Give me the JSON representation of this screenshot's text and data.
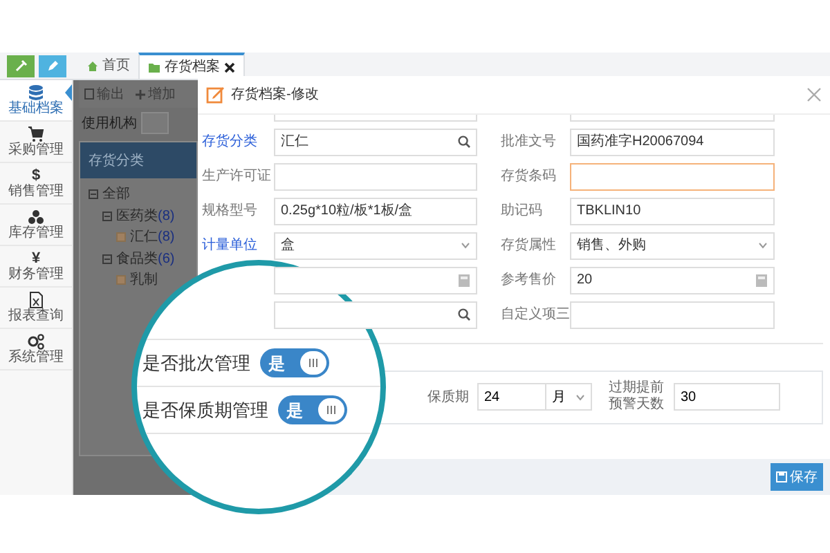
{
  "top_buttons": [
    {
      "color": "#6ab04c"
    },
    {
      "color": "#4fb3e0"
    }
  ],
  "tabs": [
    {
      "label": "首页",
      "selected": false,
      "closable": false
    },
    {
      "label": "存货档案",
      "selected": true,
      "closable": true
    }
  ],
  "sidebar": {
    "items": [
      {
        "label": "基础档案",
        "selected": true
      },
      {
        "label": "采购管理",
        "selected": false
      },
      {
        "label": "销售管理",
        "selected": false,
        "glyph": "$"
      },
      {
        "label": "库存管理",
        "selected": false
      },
      {
        "label": "财务管理",
        "selected": false,
        "glyph": "¥"
      },
      {
        "label": "报表查询",
        "selected": false
      },
      {
        "label": "系统管理",
        "selected": false
      }
    ]
  },
  "background": {
    "toolbar": [
      {
        "label": "输出"
      },
      {
        "label": "增加"
      }
    ],
    "org_label": "使用机构",
    "tree_title": "存货分类",
    "tree": [
      {
        "label": "全部",
        "expanded": true,
        "children": [
          {
            "label": "医药类",
            "count": "(8)",
            "expanded": true,
            "children": [
              {
                "label": "汇仁",
                "count": "(8)"
              }
            ]
          },
          {
            "label": "食品类",
            "count": "(6)",
            "expanded": true,
            "children": [
              {
                "label": "乳制"
              }
            ]
          }
        ]
      }
    ]
  },
  "modal": {
    "title": "存货档案-修改",
    "rows": [
      [
        {
          "label": "存货分类",
          "required": true,
          "kind": "search",
          "value": "汇仁",
          "focused": false
        },
        {
          "label": "批准文号",
          "required": false,
          "kind": "text",
          "value": "国药准字H20067094",
          "focused": false
        }
      ],
      [
        {
          "label": "生产许可证",
          "required": false,
          "kind": "text",
          "focused": false
        },
        {
          "label": "存货条码",
          "required": false,
          "kind": "text",
          "focused": true
        }
      ],
      [
        {
          "label": "规格型号",
          "required": false,
          "kind": "text",
          "value": "0.25g*10粒/板*1板/盒",
          "focused": false
        },
        {
          "label": "助记码",
          "required": false,
          "kind": "text",
          "value": "TBKLIN10",
          "focused": false
        }
      ],
      [
        {
          "label": "计量单位",
          "required": true,
          "kind": "select",
          "value": "盒",
          "focused": false
        },
        {
          "label": "存货属性",
          "required": false,
          "kind": "select",
          "value": "销售、外购",
          "focused": false
        }
      ],
      [
        {
          "kind": "number",
          "focused": false
        },
        {
          "label": "参考售价",
          "required": false,
          "kind": "number",
          "value": "20",
          "focused": false
        }
      ],
      [
        {
          "kind": "search",
          "focused": false
        },
        {
          "label": "自定义项三",
          "required": false,
          "kind": "text",
          "focused": false
        }
      ]
    ],
    "shelf_life": {
      "label": "保质期",
      "value": "24",
      "unit": "月",
      "warn_label": "过期提前预警天数",
      "warn_value": "30"
    },
    "save_button": "保存"
  },
  "magnifier": {
    "toggles": [
      {
        "label": "是否批次管理",
        "on": true,
        "text": "是"
      },
      {
        "label": "是否保质期管理",
        "on": true,
        "text": "是"
      }
    ]
  }
}
